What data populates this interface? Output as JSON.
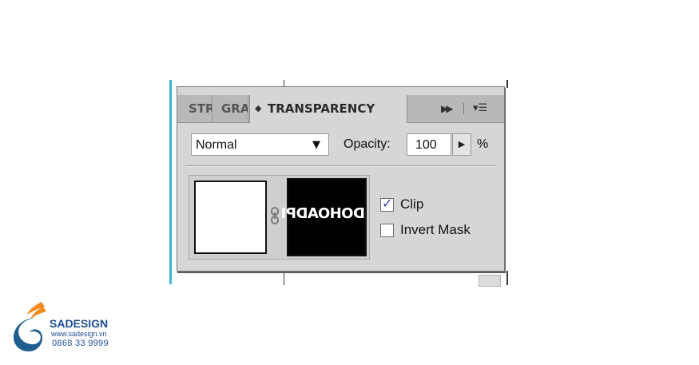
{
  "panel": {
    "tabs": [
      {
        "label": "STROKE",
        "active": false
      },
      {
        "label": "GRADIENT",
        "active": false
      },
      {
        "label": "TRANSPARENCY",
        "active": true
      }
    ],
    "tab_arrows_icon": "⇕",
    "collapse_icon": "double-arrow-right",
    "menu_icon": "panel-menu",
    "blend_mode": "Normal",
    "opacity_label": "Opacity:",
    "opacity_value": "100",
    "opacity_unit": "%",
    "mask_text": "DOHOADPI",
    "clip_label": "Clip",
    "clip_checked": true,
    "invert_mask_label": "Invert Mask",
    "invert_mask_checked": false
  },
  "watermark": {
    "brand": "SADESIGN",
    "url": "www.sadesign.vn",
    "phone": "0868 33 9999",
    "colors": {
      "orange": "#f28a1e",
      "blue": "#1d4d92"
    }
  }
}
